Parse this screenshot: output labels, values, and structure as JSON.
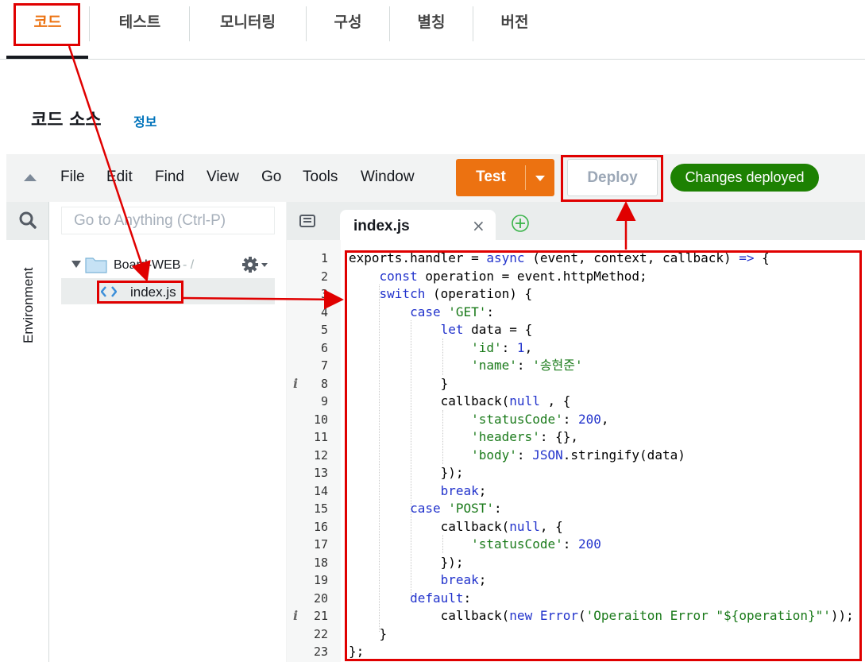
{
  "tabs": [
    {
      "label": "코드"
    },
    {
      "label": "테스트"
    },
    {
      "label": "모니터링"
    },
    {
      "label": "구성"
    },
    {
      "label": "별칭"
    },
    {
      "label": "버전"
    }
  ],
  "panel": {
    "title": "코드 소스",
    "info_link": "정보"
  },
  "menubar": {
    "items": [
      "File",
      "Edit",
      "Find",
      "View",
      "Go",
      "Tools",
      "Window"
    ],
    "test_label": "Test",
    "deploy_label": "Deploy",
    "status": "Changes deployed"
  },
  "sidebar": {
    "environment_label": "Environment",
    "goto_placeholder": "Go to Anything (Ctrl-P)",
    "folder_name": "Board-WEB",
    "folder_path": "- /",
    "file_name": "index.js"
  },
  "editor": {
    "tab_label": "index.js",
    "close_glyph": "×",
    "line_numbers": [
      "1",
      "2",
      "3",
      "4",
      "5",
      "6",
      "7",
      "8",
      "9",
      "10",
      "11",
      "12",
      "13",
      "14",
      "15",
      "16",
      "17",
      "18",
      "19",
      "20",
      "21",
      "22",
      "23"
    ],
    "info_markers": [
      8,
      21
    ],
    "code_lines": [
      "exports.handler = async (event, context, callback) => {",
      "    const operation = event.httpMethod;",
      "    switch (operation) {",
      "        case 'GET':",
      "            let data = {",
      "                'id': 1,",
      "                'name': '송현준'",
      "            }",
      "            callback(null , {",
      "                'statusCode': 200,",
      "                'headers': {},",
      "                'body': JSON.stringify(data)",
      "            });",
      "            break;",
      "        case 'POST':",
      "            callback(null, {",
      "                'statusCode': 200",
      "            });",
      "            break;",
      "        default:",
      "            callback(new Error('Operaiton Error \"${operation}\"'));",
      "    }",
      "};"
    ]
  },
  "colors": {
    "accent_orange": "#ec7211",
    "status_green": "#1d8102",
    "link_blue": "#0073bb",
    "annotation_red": "#e00000",
    "keyword_blue": "#2233cc",
    "string_green": "#1a7a1a"
  }
}
